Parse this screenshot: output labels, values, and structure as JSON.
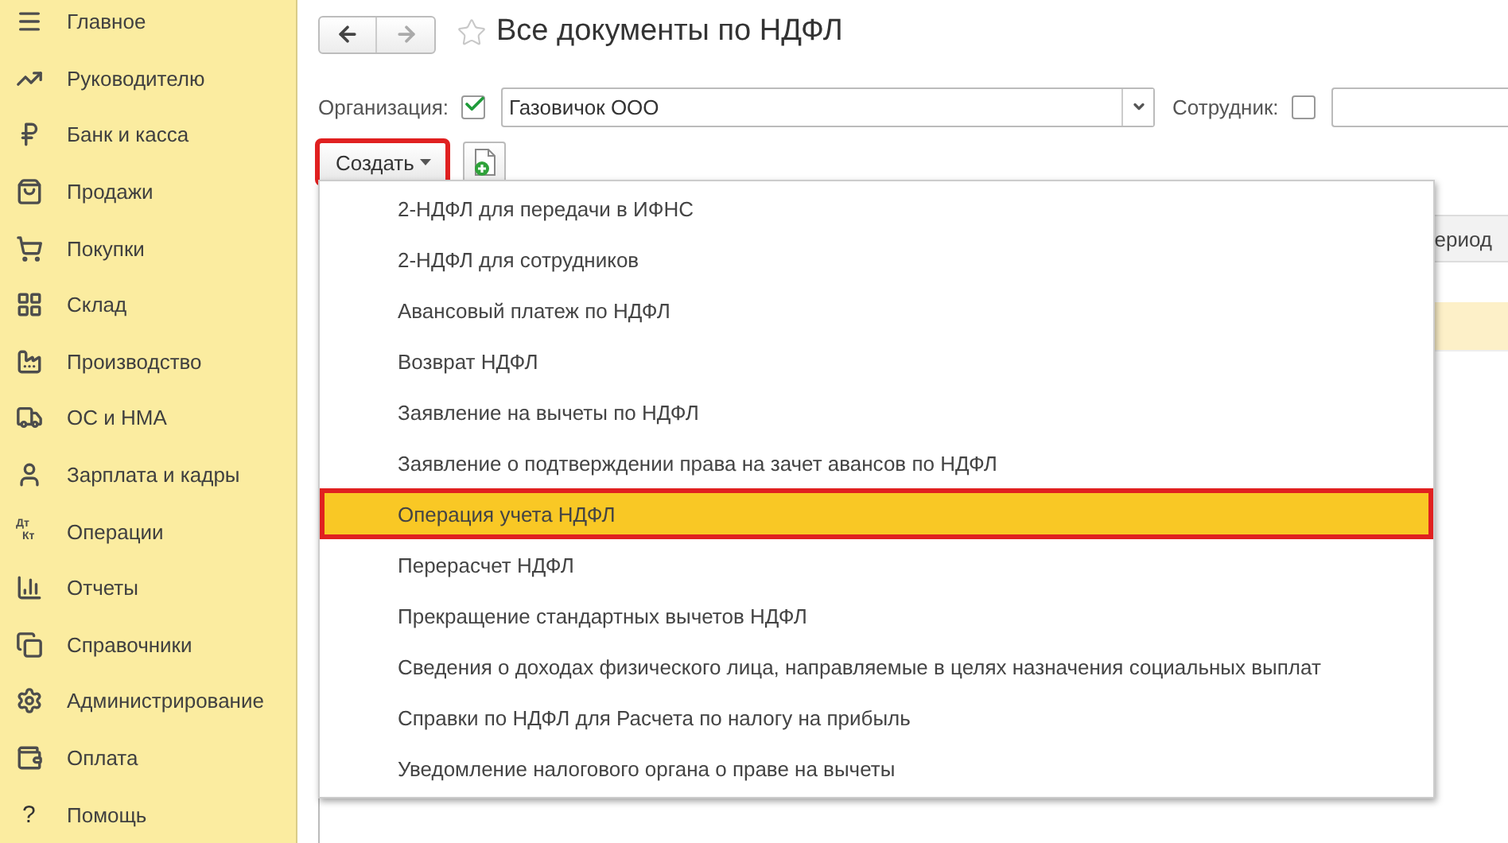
{
  "sidebar": {
    "items": [
      {
        "label": "Главное"
      },
      {
        "label": "Руководителю"
      },
      {
        "label": "Банк и касса"
      },
      {
        "label": "Продажи"
      },
      {
        "label": "Покупки"
      },
      {
        "label": "Склад"
      },
      {
        "label": "Производство"
      },
      {
        "label": "ОС и НМА"
      },
      {
        "label": "Зарплата и кадры"
      },
      {
        "label": "Операции",
        "icon_text": [
          "Дт",
          "Кт"
        ]
      },
      {
        "label": "Отчеты"
      },
      {
        "label": "Справочники"
      },
      {
        "label": "Администрирование"
      },
      {
        "label": "Оплата"
      },
      {
        "label": "Помощь",
        "icon_text": [
          "?"
        ]
      }
    ]
  },
  "header": {
    "title": "Все документы по НДФЛ",
    "favorite": false
  },
  "filters": {
    "organization": {
      "label": "Организация:",
      "checked": true,
      "value": "Газовичок ООО"
    },
    "employee": {
      "label": "Сотрудник:",
      "checked": false
    }
  },
  "toolbar": {
    "create_button": {
      "label": "Создать",
      "highlighted": true
    }
  },
  "table": {
    "column_header": "ериод"
  },
  "create_menu": {
    "items": [
      {
        "label": "2-НДФЛ для передачи в ИФНС",
        "selected": false
      },
      {
        "label": "2-НДФЛ для сотрудников",
        "selected": false
      },
      {
        "label": "Авансовый платеж по НДФЛ",
        "selected": false
      },
      {
        "label": "Возврат НДФЛ",
        "selected": false
      },
      {
        "label": "Заявление на вычеты по НДФЛ",
        "selected": false
      },
      {
        "label": "Заявление о подтверждении права на зачет авансов по НДФЛ",
        "selected": false
      },
      {
        "label": "Операция учета НДФЛ",
        "selected": true
      },
      {
        "label": "Перерасчет НДФЛ",
        "selected": false
      },
      {
        "label": "Прекращение стандартных вычетов НДФЛ",
        "selected": false
      },
      {
        "label": "Сведения о доходах физического лица, направляемые в целях назначения социальных выплат",
        "selected": false
      },
      {
        "label": "Справки по НДФЛ для Расчета по налогу на прибыль",
        "selected": false
      },
      {
        "label": "Уведомление налогового органа о праве на вычеты",
        "selected": false
      }
    ]
  }
}
